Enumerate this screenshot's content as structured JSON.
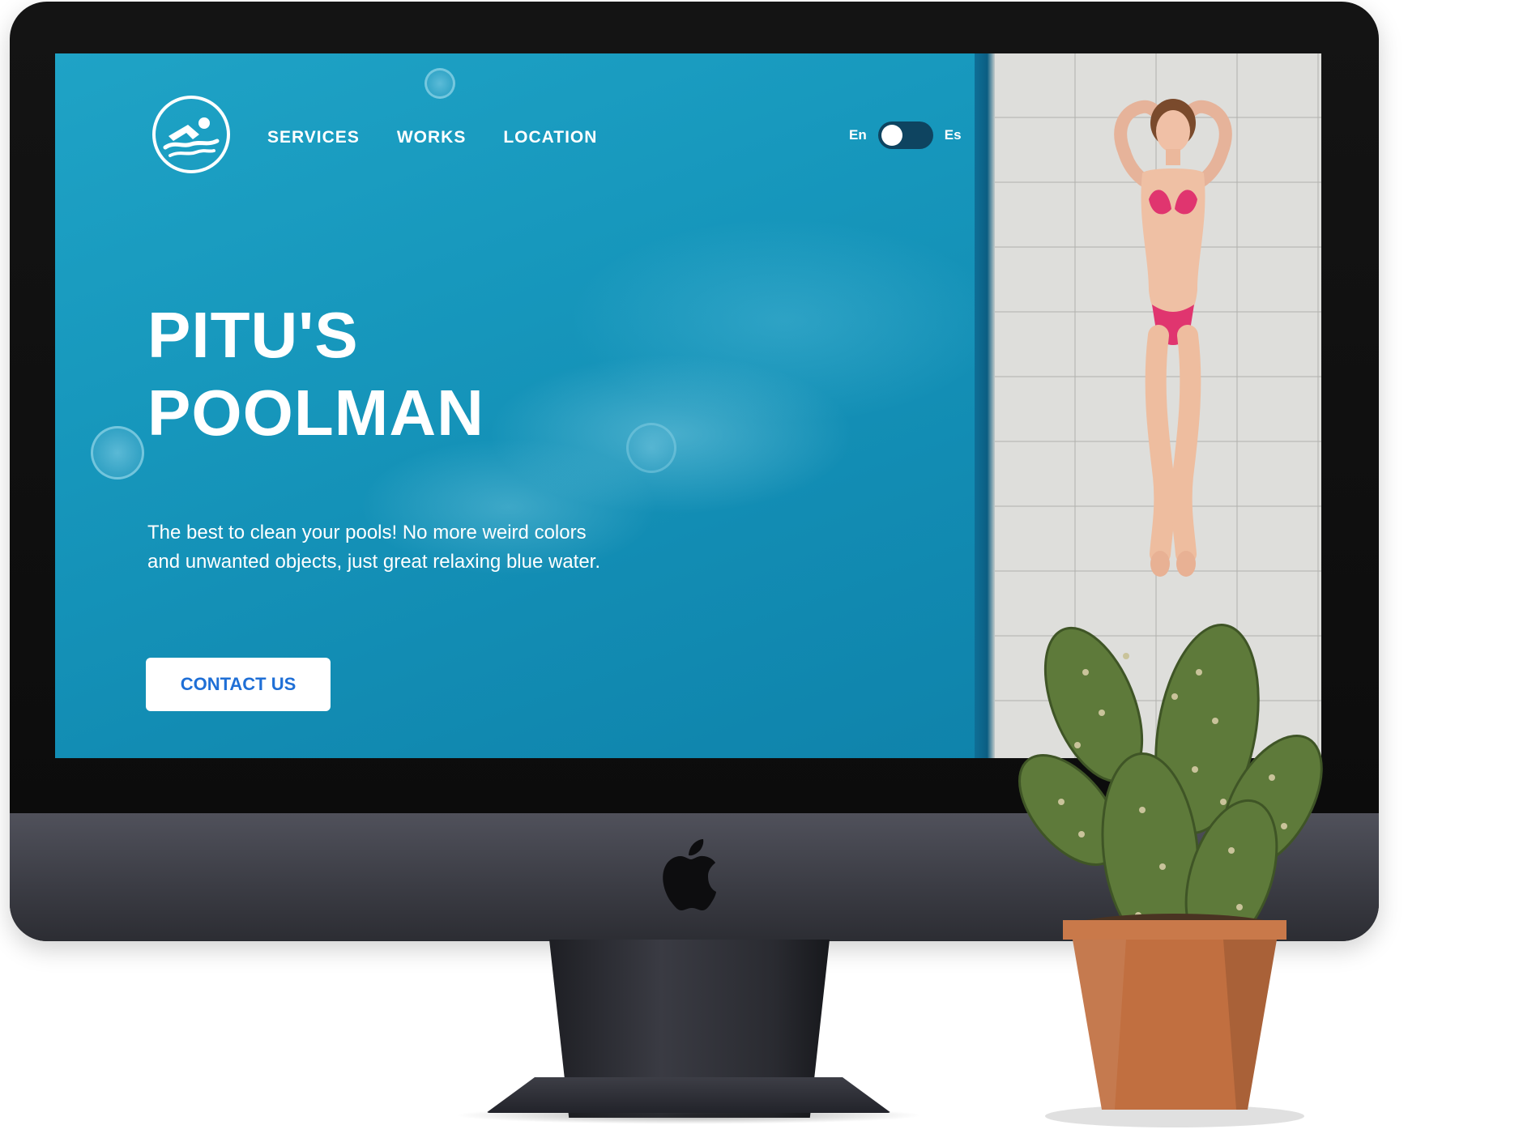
{
  "site": {
    "nav": {
      "items": [
        {
          "label": "SERVICES"
        },
        {
          "label": "WORKS"
        },
        {
          "label": "LOCATION"
        }
      ]
    },
    "language": {
      "left": "En",
      "right": "Es"
    },
    "hero": {
      "title_line1": "PITU'S",
      "title_line2": "POOLMAN",
      "tagline_line1": "The best to clean your pools! No more weird colors",
      "tagline_line2": "and unwanted objects, just great relaxing blue water.",
      "cta_label": "CONTACT US"
    }
  },
  "icons": {
    "logo": "swimmer-logo-icon",
    "device_logo": "apple-logo-icon"
  },
  "colors": {
    "pool_blue": "#1798bd",
    "cta_text": "#1f6fd6",
    "toggle_track": "#0e4460",
    "bikini": "#e0356f",
    "deck_stone": "#dededb"
  }
}
